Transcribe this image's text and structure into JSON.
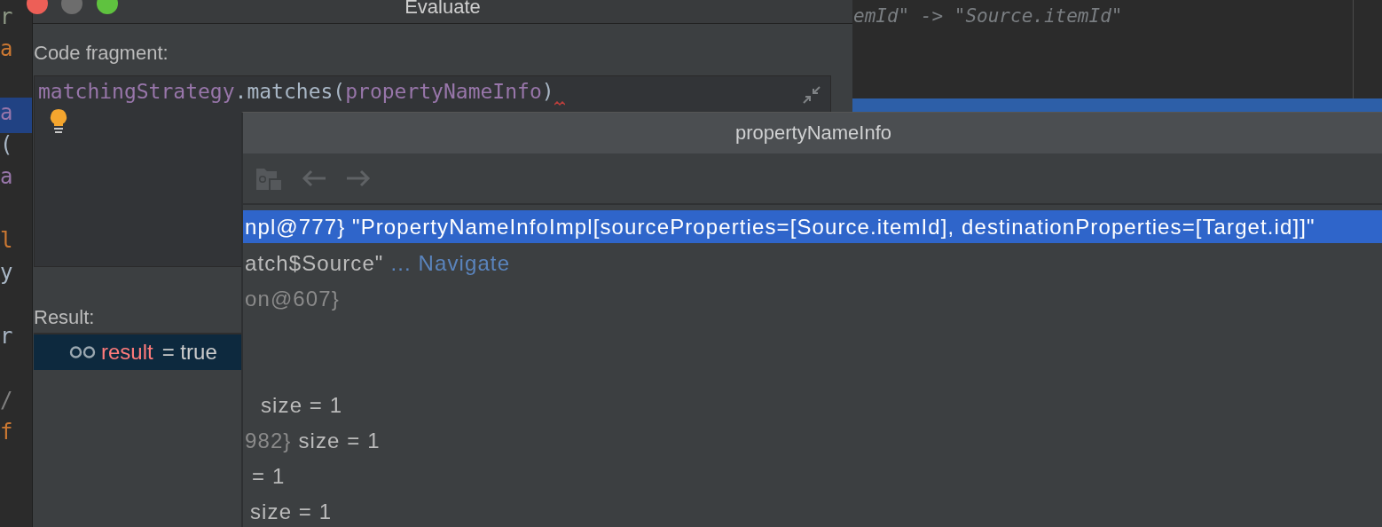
{
  "background_editor": {
    "left_fragments": [
      {
        "text": "r",
        "color": "#8f9a86"
      },
      {
        "text": "a",
        "color": "#cc7832"
      },
      {
        "text": "a",
        "color": "#9876aa"
      },
      {
        "text": "(",
        "color": "#a9b7c6"
      },
      {
        "text": "a",
        "color": "#9876aa"
      },
      {
        "text": "l",
        "color": "#cc7832"
      },
      {
        "text": "y",
        "color": "#a9b7c6"
      },
      {
        "text": "r",
        "color": "#a9b7c6"
      },
      {
        "text": "/",
        "color": "#808080"
      },
      {
        "text": "f",
        "color": "#cc7832"
      }
    ],
    "right_line": "emId\" -> \"Source.itemId\""
  },
  "dialog": {
    "title": "Evaluate",
    "code_label": "Code fragment:",
    "code": [
      {
        "text": "matchingStrategy",
        "kind": "field"
      },
      {
        "text": ".matches(",
        "kind": "plain"
      },
      {
        "text": "propertyNameInfo",
        "kind": "field"
      },
      {
        "text": ")",
        "kind": "plain"
      }
    ],
    "result_label": "Result:",
    "result": {
      "name": "result",
      "value": "= true",
      "selected": true
    }
  },
  "popup": {
    "title": "propertyNameInfo",
    "rows": [
      {
        "selected": true,
        "segments": [
          {
            "text": "npl@777} \"PropertyNameInfoImpl[sourceProperties=[Source.itemId], destinationProperties=[Target.id]]\"",
            "kind": "value"
          }
        ]
      },
      {
        "selected": false,
        "segments": [
          {
            "text": "atch$Source\"",
            "kind": "value"
          },
          {
            "text": "... Navigate",
            "kind": "link"
          }
        ]
      },
      {
        "selected": false,
        "segments": [
          {
            "text": "on@607}",
            "kind": "dim"
          }
        ]
      },
      {
        "selected": false,
        "segments": [
          {
            "text": "size = 1",
            "kind": "value"
          }
        ]
      },
      {
        "selected": false,
        "segments": [
          {
            "text": "982}",
            "kind": "dim"
          },
          {
            "text": "size = 1",
            "kind": "value"
          }
        ]
      },
      {
        "selected": false,
        "segments": [
          {
            "text": "= 1",
            "kind": "value"
          }
        ]
      },
      {
        "selected": false,
        "segments": [
          {
            "text": "size = 1",
            "kind": "value"
          }
        ]
      }
    ]
  }
}
